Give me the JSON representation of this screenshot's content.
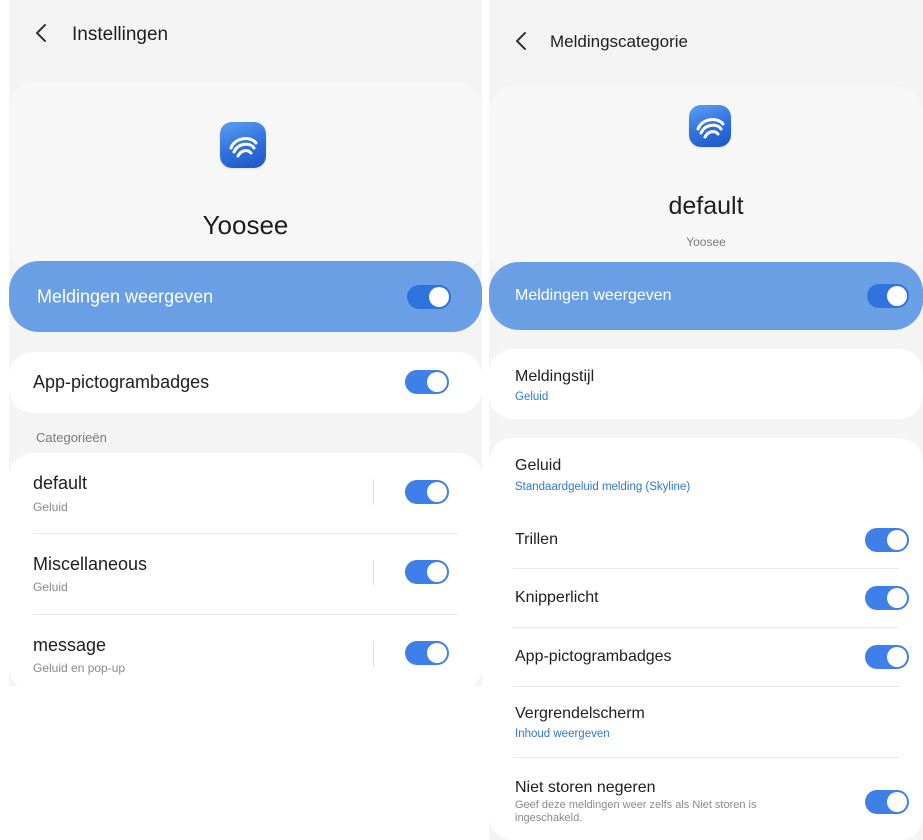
{
  "left": {
    "header": {
      "title": "Instellingen"
    },
    "app": {
      "name": "Yoosee",
      "icon": "yoosee-app-icon"
    },
    "master": {
      "label": "Meldingen weergeven",
      "on": true
    },
    "badges": {
      "label": "App-pictogrambadges",
      "on": true
    },
    "section_label": "Categorieën",
    "categories": [
      {
        "title": "default",
        "subtitle": "Geluid",
        "on": true
      },
      {
        "title": "Miscellaneous",
        "subtitle": "Geluid",
        "on": true
      },
      {
        "title": "message",
        "subtitle": "Geluid en pop-up",
        "on": true
      }
    ]
  },
  "right": {
    "header": {
      "title": "Meldingscategorie"
    },
    "category": {
      "name": "default",
      "app": "Yoosee",
      "icon": "yoosee-app-icon"
    },
    "master": {
      "label": "Meldingen weergeven",
      "on": true
    },
    "style": {
      "title": "Meldingstijl",
      "value": "Geluid"
    },
    "settings": {
      "sound": {
        "title": "Geluid",
        "value": "Standaardgeluid melding (Skyline)"
      },
      "vibrate": {
        "title": "Trillen",
        "on": true
      },
      "led": {
        "title": "Knipperlicht",
        "on": true
      },
      "badges": {
        "title": "App-pictogrambadges",
        "on": true
      },
      "lockscreen": {
        "title": "Vergrendelscherm",
        "value": "Inhoud weergeven"
      },
      "dnd": {
        "title": "Niet storen negeren",
        "desc": "Geef deze meldingen weer zelfs als Niet storen is ingeschakeld.",
        "on": true
      }
    }
  },
  "colors": {
    "accent": "#3f7fe8",
    "highlight": "#6a9fe6",
    "link": "#2f78d2",
    "background": "#f4f4f4"
  }
}
